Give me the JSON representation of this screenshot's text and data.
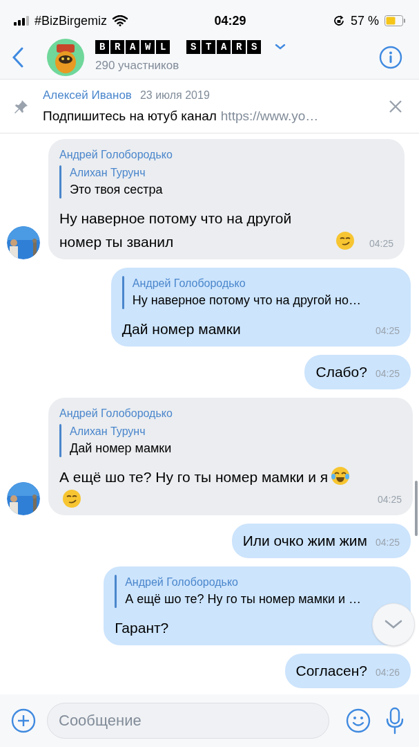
{
  "status_bar": {
    "carrier": "#BizBirgemiz",
    "time": "04:29",
    "battery": "57 %"
  },
  "header": {
    "title": "BRAWL STARS",
    "subtitle": "290 участников"
  },
  "pinned": {
    "author": "Алексей Иванов",
    "date": "23 июля 2019",
    "text": "Подпишитесь на ютуб канал",
    "link": "https://www.yo…"
  },
  "messages": [
    {
      "kind": "incoming",
      "author": "Андрей Голобородько",
      "reply": {
        "author": "Алихан Турунч",
        "text": "Это твоя сестра"
      },
      "text": "Ну наверное потому что на другой номер ты званил",
      "emojis": [
        {
          "kind": "smirk"
        }
      ],
      "time": "04:25"
    },
    {
      "kind": "outgoing",
      "reply": {
        "author": "Андрей Голобородько",
        "text": "Ну наверное потому что на другой но…"
      },
      "text": "Дай номер мамки",
      "time": "04:25"
    },
    {
      "kind": "outgoing",
      "text": "Слабо?",
      "time": "04:25"
    },
    {
      "kind": "incoming",
      "author": "Андрей Голобородько",
      "reply": {
        "author": "Алихан Турунч",
        "text": "Дай номер мамки"
      },
      "text": "А ещё шо те? Ну го ты номер мамки и я",
      "emojis": [
        {
          "kind": "joy"
        },
        {
          "kind": "smirk"
        }
      ],
      "time": "04:25"
    },
    {
      "kind": "outgoing",
      "text": "Или очко жим жим",
      "time": "04:25"
    },
    {
      "kind": "outgoing",
      "reply": {
        "author": "Андрей Голобородько",
        "text": "А ещё шо те? Ну го ты номер мамки и …"
      },
      "text": "Гарант?"
    },
    {
      "kind": "outgoing",
      "text": "Согласен?",
      "time": "04:26"
    }
  ],
  "composer": {
    "placeholder": "Сообщение"
  }
}
